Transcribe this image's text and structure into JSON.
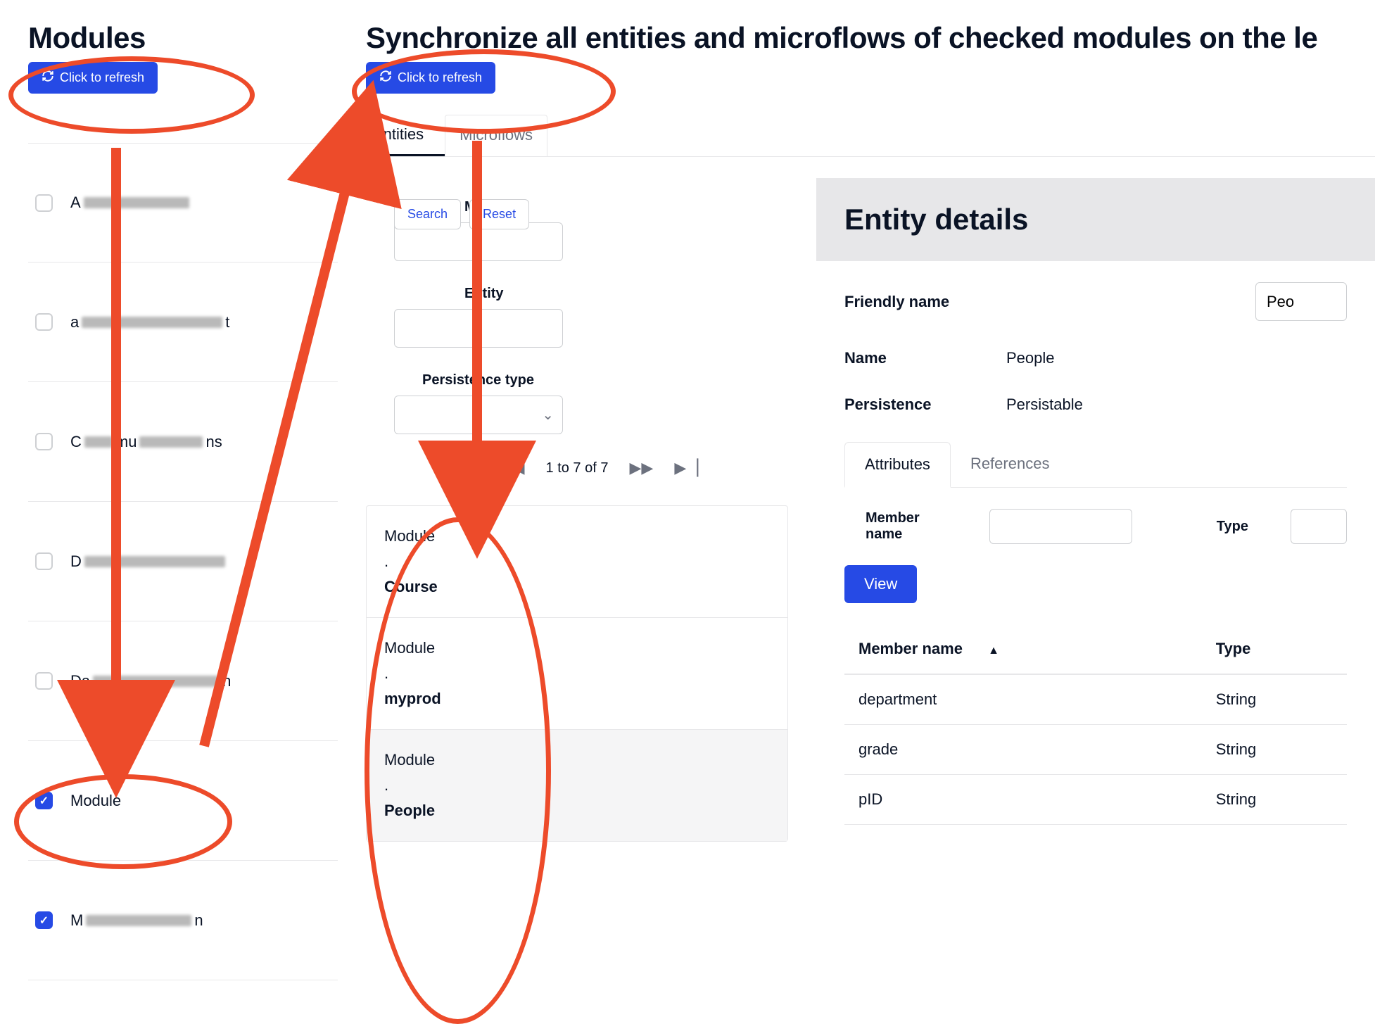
{
  "left": {
    "title": "Modules",
    "refresh_label": "Click to refresh",
    "items": [
      {
        "label_prefix": "A",
        "label_suffix": "",
        "checked": false,
        "redacted": true
      },
      {
        "label_prefix": "a",
        "label_suffix": "t",
        "checked": false,
        "redacted": true
      },
      {
        "label_prefix": "C",
        "label_mid": "mu",
        "label_suffix": "ns",
        "checked": false,
        "redacted": true
      },
      {
        "label_prefix": "D",
        "label_suffix": "",
        "checked": false,
        "redacted": true
      },
      {
        "label_prefix": "Da",
        "label_suffix": "n",
        "checked": false,
        "redacted": true
      },
      {
        "label": "Module",
        "checked": true,
        "redacted": false
      },
      {
        "label_prefix": "M",
        "label_suffix": "n",
        "checked": true,
        "redacted": true
      }
    ]
  },
  "right": {
    "title": "Synchronize all entities and microflows of checked modules on the le",
    "refresh_label": "Click to refresh",
    "tabs": [
      "Entities",
      "Microflows"
    ],
    "active_tab": 0,
    "filters": {
      "module_label": "Module",
      "entity_label": "Entity",
      "persistence_label": "Persistence type",
      "search_label": "Search",
      "reset_label": "Reset"
    },
    "pager": "1 to 7 of 7",
    "entities": [
      {
        "module": "Module",
        "name": "Course"
      },
      {
        "module": "Module",
        "name": "myprod"
      },
      {
        "module": "Module",
        "name": "People",
        "selected": true
      }
    ]
  },
  "details": {
    "title": "Entity details",
    "friendly_name_label": "Friendly name",
    "friendly_name_value": "Peo",
    "name_label": "Name",
    "name_value": "People",
    "persistence_label": "Persistence",
    "persistence_value": "Persistable",
    "tabs": [
      "Attributes",
      "References"
    ],
    "active_tab": 0,
    "member_name_label": "Member name",
    "type_label": "Type",
    "view_label": "View",
    "table": {
      "cols": [
        "Member name",
        "Type"
      ],
      "rows": [
        {
          "member": "department",
          "type": "String"
        },
        {
          "member": "grade",
          "type": "String"
        },
        {
          "member": "pID",
          "type": "String"
        }
      ]
    }
  }
}
